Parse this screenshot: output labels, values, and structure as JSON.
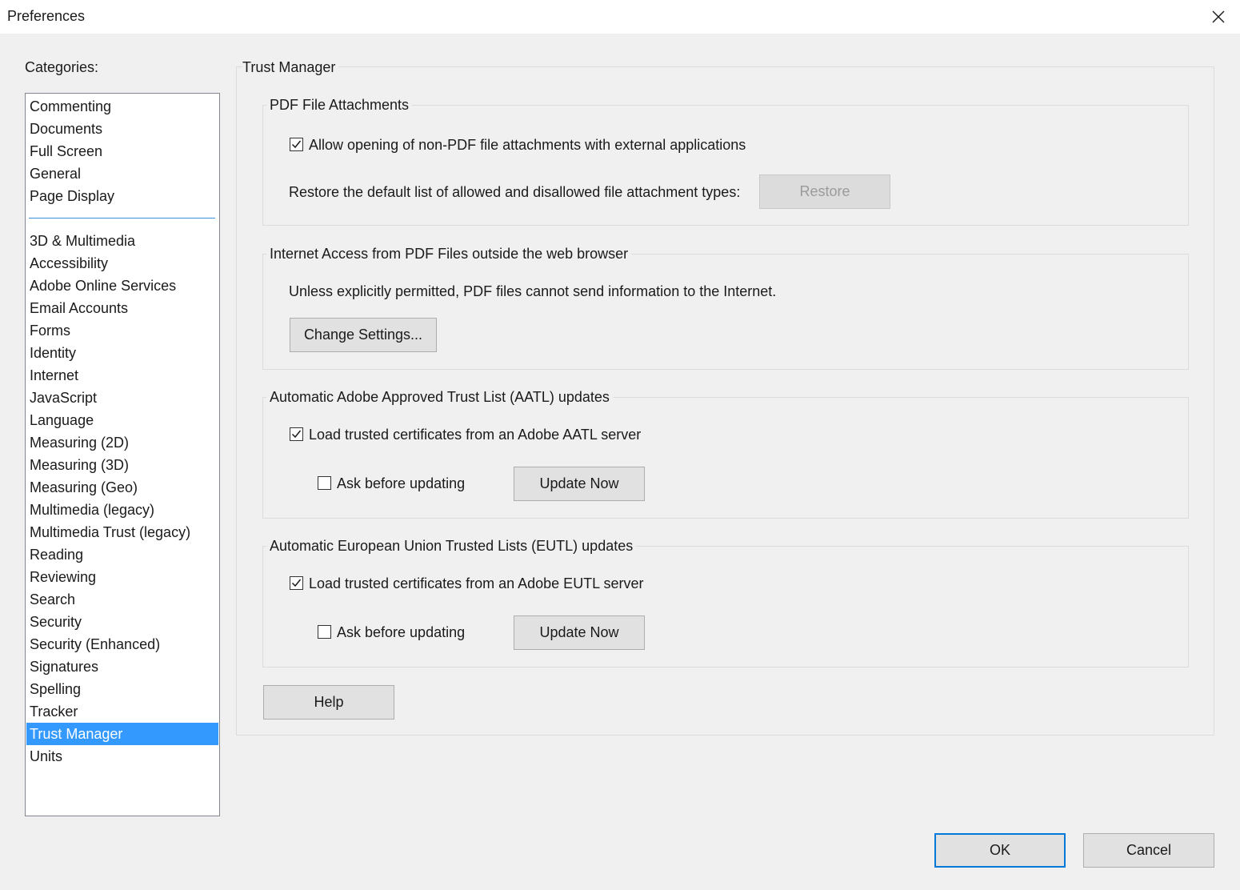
{
  "window": {
    "title": "Preferences"
  },
  "categories": {
    "label": "Categories:",
    "top_items": [
      "Commenting",
      "Documents",
      "Full Screen",
      "General",
      "Page Display"
    ],
    "items": [
      "3D & Multimedia",
      "Accessibility",
      "Adobe Online Services",
      "Email Accounts",
      "Forms",
      "Identity",
      "Internet",
      "JavaScript",
      "Language",
      "Measuring (2D)",
      "Measuring (3D)",
      "Measuring (Geo)",
      "Multimedia (legacy)",
      "Multimedia Trust (legacy)",
      "Reading",
      "Reviewing",
      "Search",
      "Security",
      "Security (Enhanced)",
      "Signatures",
      "Spelling",
      "Tracker",
      "Trust Manager",
      "Units"
    ],
    "selected": "Trust Manager"
  },
  "panel": {
    "title": "Trust Manager",
    "attachments": {
      "title": "PDF File Attachments",
      "allow_label": "Allow opening of non-PDF file attachments with external applications",
      "allow_checked": true,
      "restore_text": "Restore the default list of allowed and disallowed file attachment types:",
      "restore_button": "Restore"
    },
    "internet": {
      "title": "Internet Access from PDF Files outside the web browser",
      "text": "Unless explicitly permitted, PDF files cannot send information to the Internet.",
      "button": "Change Settings..."
    },
    "aatl": {
      "title": "Automatic Adobe Approved Trust List (AATL) updates",
      "load_label": "Load trusted certificates from an Adobe AATL server",
      "load_checked": true,
      "ask_label": "Ask before updating",
      "ask_checked": false,
      "button": "Update Now"
    },
    "eutl": {
      "title": "Automatic European Union Trusted Lists (EUTL) updates",
      "load_label": "Load trusted certificates from an Adobe EUTL server",
      "load_checked": true,
      "ask_label": "Ask before updating",
      "ask_checked": false,
      "button": "Update Now"
    },
    "help_button": "Help"
  },
  "footer": {
    "ok": "OK",
    "cancel": "Cancel"
  }
}
